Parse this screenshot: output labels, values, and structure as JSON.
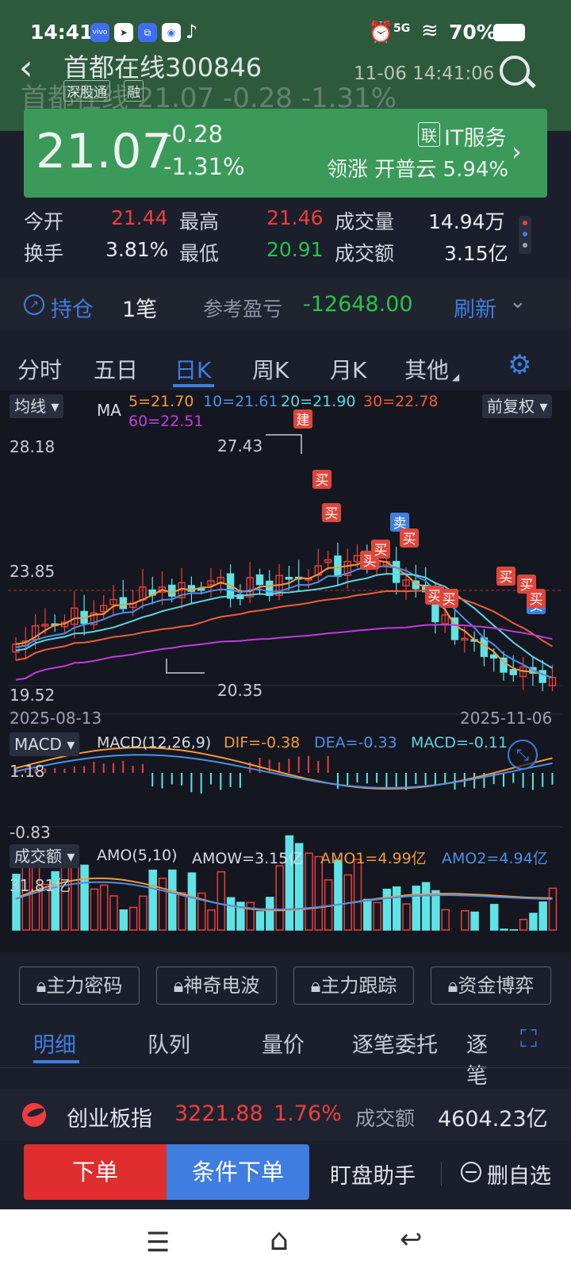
{
  "status": {
    "time": "14:41",
    "battery": "70%",
    "network": "5G",
    "app_icons": [
      "vivo",
      "telegram",
      "link",
      "pin",
      "tiktok"
    ]
  },
  "header": {
    "title": "首都在线300846",
    "tags": [
      "深股通",
      "融"
    ],
    "datetime": "11-06 14:41:06",
    "ghost_text": "首都在线   21.07   -0.28   -1.31%"
  },
  "quote": {
    "price": "21.07",
    "change": "-0.28",
    "change_pct": "-1.31%",
    "sector_tag": "联",
    "sector": "IT服务",
    "lead_text": "领涨 开普云 5.94%"
  },
  "stats": {
    "open_label": "今开",
    "open": "21.44",
    "high_label": "最高",
    "high": "21.46",
    "vol_label": "成交量",
    "vol": "14.94万",
    "turnover_label": "换手",
    "turnover": "3.81%",
    "low_label": "最低",
    "low": "20.91",
    "amount_label": "成交额",
    "amount": "3.15亿"
  },
  "position": {
    "label": "持仓",
    "count": "1笔",
    "pnl_label": "参考盈亏",
    "pnl": "-12648.00",
    "refresh": "刷新"
  },
  "tabs": [
    "分时",
    "五日",
    "日K",
    "周K",
    "月K",
    "其他"
  ],
  "active_tab": "日K",
  "kline": {
    "indicator": "均线",
    "ma_label": "MA",
    "ma5": "5=21.70",
    "ma10": "10=21.61",
    "ma20": "20=21.90",
    "ma30": "30=22.78",
    "ma60": "60=22.51",
    "adjust": "前复权",
    "y_top": "28.18",
    "y_mid": "23.85",
    "y_bot": "19.52",
    "high_mark": "27.43",
    "low_mark": "20.35",
    "date_start": "2025-08-13",
    "date_end": "2025-11-06",
    "signals": [
      "建",
      "买",
      "买",
      "卖",
      "买",
      "买",
      "买",
      "买",
      "买",
      "买",
      "卖",
      "买",
      "买"
    ]
  },
  "macd": {
    "indicator": "MACD",
    "params": "MACD(12,26,9)",
    "dif": "DIF=-0.38",
    "dea": "DEA=-0.33",
    "macd": "MACD=-0.11",
    "y_top": "1.18",
    "y_bot": "-0.83"
  },
  "amount": {
    "indicator": "成交额",
    "params": "AMO(5,10)",
    "amow": "AMOW=3.15亿",
    "amo1": "AMO1=4.99亿",
    "amo2": "AMO2=4.94亿",
    "y_top": "31.81亿"
  },
  "tools": [
    "主力密码",
    "神奇电波",
    "主力跟踪",
    "资金博弈"
  ],
  "content_tabs": [
    "明细",
    "队列",
    "量价",
    "逐笔委托",
    "逐笔"
  ],
  "index_bar": {
    "name": "创业板指",
    "value": "3221.88",
    "pct": "1.76%",
    "amount_label": "成交额",
    "amount": "4604.23亿"
  },
  "actions": {
    "order": "下单",
    "cond_order": "条件下单",
    "watch": "盯盘助手",
    "remove": "删自选"
  },
  "colors": {
    "up": "#ef3d3d",
    "down": "#5fe3e6",
    "card": "#3b9a5a",
    "blue": "#3f7de0"
  }
}
